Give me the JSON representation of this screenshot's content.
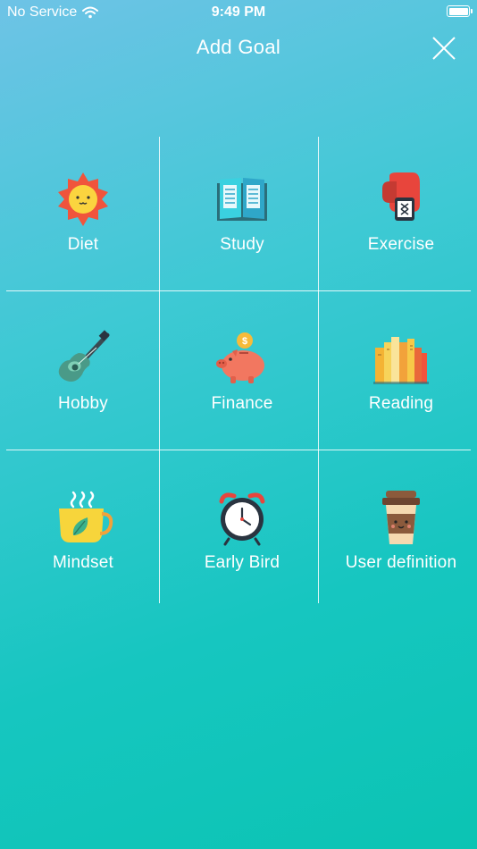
{
  "status_bar": {
    "carrier": "No Service",
    "time": "9:49 PM"
  },
  "nav": {
    "title": "Add Goal"
  },
  "goals": [
    {
      "label": "Diet"
    },
    {
      "label": "Study"
    },
    {
      "label": "Exercise"
    },
    {
      "label": "Hobby"
    },
    {
      "label": "Finance"
    },
    {
      "label": "Reading"
    },
    {
      "label": "Mindset"
    },
    {
      "label": "Early Bird"
    },
    {
      "label": "User definition"
    }
  ],
  "colors": {
    "bg_top": "#6ec3e6",
    "bg_bottom": "#0bc4b3",
    "text": "#ffffff"
  }
}
